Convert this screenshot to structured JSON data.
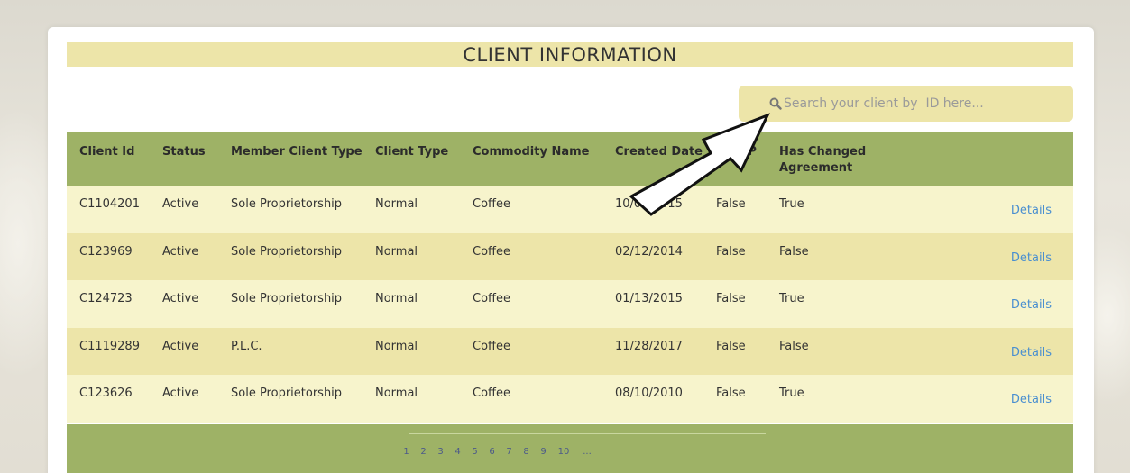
{
  "title": "CLIENT INFORMATION",
  "search": {
    "placeholder": "Search your client by  ID here...",
    "icon": "search-icon"
  },
  "table": {
    "headers": [
      "Client Id",
      "Status",
      "Member Client Type",
      "Client Type",
      "Commodity Name",
      "Created Date",
      "Is STP",
      "Has Changed Agreement",
      ""
    ],
    "rows": [
      [
        "C1104201",
        "Active",
        "Sole Proprietorship",
        "Normal",
        "Coffee",
        "10/07/2015",
        "False",
        "True",
        "Details"
      ],
      [
        "C123969",
        "Active",
        "Sole Proprietorship",
        "Normal",
        "Coffee",
        "02/12/2014",
        "False",
        "False",
        "Details"
      ],
      [
        "C124723",
        "Active",
        "Sole Proprietorship",
        "Normal",
        "Coffee",
        "01/13/2015",
        "False",
        "True",
        "Details"
      ],
      [
        "C1119289",
        "Active",
        "P.L.C.",
        "Normal",
        "Coffee",
        "11/28/2017",
        "False",
        "False",
        "Details"
      ],
      [
        "C123626",
        "Active",
        "Sole Proprietorship",
        "Normal",
        "Coffee",
        "08/10/2010",
        "False",
        "True",
        "Details"
      ]
    ]
  },
  "pagination": {
    "pages": [
      "1",
      "2",
      "3",
      "4",
      "5",
      "6",
      "7",
      "8",
      "9",
      "10",
      "..."
    ]
  },
  "colors": {
    "header_green": "#9eb266",
    "row_light": "#f7f4cc",
    "row_dark": "#ede5a9",
    "link_blue": "#4a8fd0"
  }
}
